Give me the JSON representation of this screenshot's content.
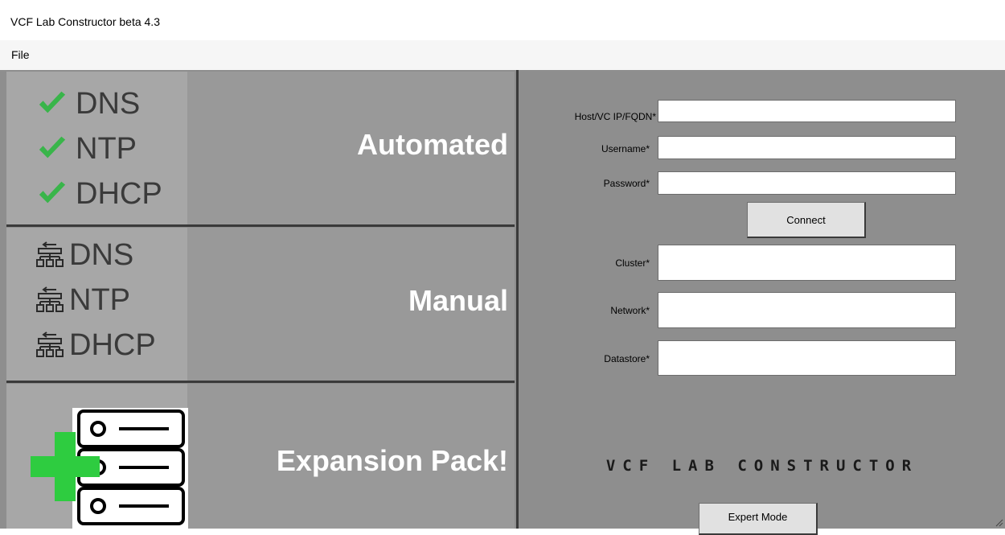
{
  "window": {
    "title": "VCF Lab Constructor beta 4.3"
  },
  "menu": {
    "file": "File"
  },
  "modes": {
    "automated": {
      "label": "Automated",
      "items": [
        "DNS",
        "NTP",
        "DHCP"
      ]
    },
    "manual": {
      "label": "Manual",
      "items": [
        "DNS",
        "NTP",
        "DHCP"
      ]
    },
    "expansion": {
      "label": "Expansion Pack!"
    }
  },
  "form": {
    "host_label": "Host/VC IP/FQDN*",
    "host_value": "",
    "username_label": "Username*",
    "username_value": "",
    "password_label": "Password*",
    "password_value": "",
    "connect_button": "Connect",
    "cluster_label": "Cluster*",
    "cluster_value": "",
    "network_label": "Network*",
    "network_value": "",
    "datastore_label": "Datastore*",
    "datastore_value": ""
  },
  "logo": {
    "text": "VCF LAB CONSTRUCTOR"
  },
  "expert_button": "Expert Mode",
  "colors": {
    "panel_bg": "#8e8e8e",
    "mode_bg": "#999999",
    "icon_bg": "#a7a7a7",
    "check_green": "#39b54a",
    "plus_green": "#2ecc40",
    "mode_text": "#ffffff"
  },
  "icons": {
    "check": "check-icon",
    "network": "network-icon",
    "server_stack": "server-stack-icon",
    "plus": "plus-icon"
  }
}
